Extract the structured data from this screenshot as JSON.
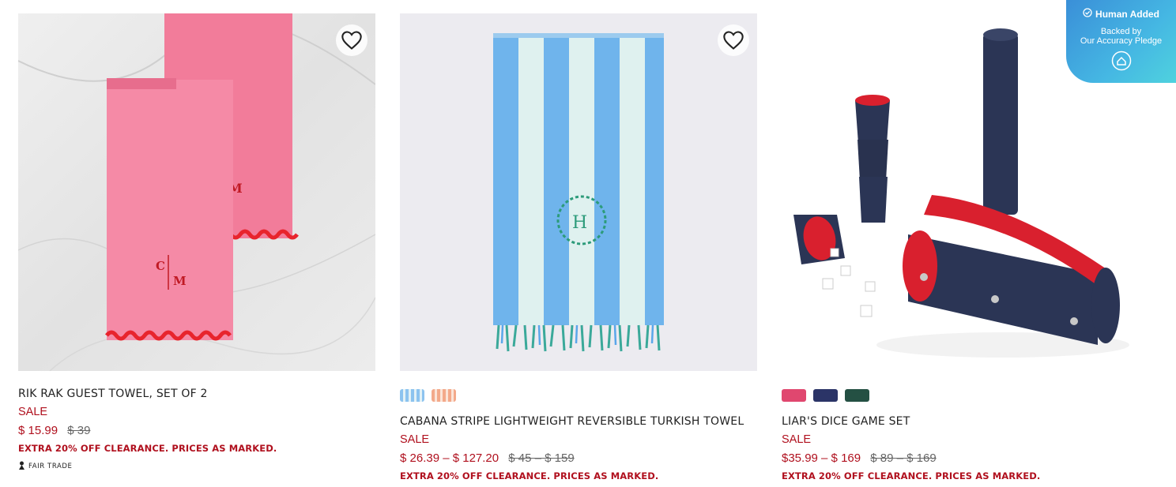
{
  "products": [
    {
      "title": "RIK RAK GUEST TOWEL, SET OF 2",
      "sale_label": "SALE",
      "price_now": "$ 15.99",
      "price_was": "$ 39",
      "promo": "EXTRA 20% OFF CLEARANCE. PRICES AS MARKED.",
      "badge_label": "FAIR TRADE",
      "monogram": "C|M"
    },
    {
      "title": "CABANA STRIPE LIGHTWEIGHT REVERSIBLE TURKISH TOWEL",
      "sale_label": "SALE",
      "price_now": "$ 26.39 – $ 127.20",
      "price_was": "$ 45 – $ 159",
      "promo": "EXTRA 20% OFF CLEARANCE. PRICES AS MARKED.",
      "monogram": "H",
      "swatches": [
        "blue-stripe",
        "peach-stripe"
      ]
    },
    {
      "title": "LIAR'S DICE GAME SET",
      "sale_label": "SALE",
      "price_now": "$35.99 – $ 169",
      "price_was": "$ 89 – $ 169",
      "promo": "EXTRA 20% OFF CLEARANCE. PRICES AS MARKED.",
      "swatches": [
        "#e0476f",
        "#2b3467",
        "#245043"
      ]
    }
  ],
  "overlay": {
    "human_added": "Human Added",
    "backed_by": "Backed by",
    "pledge": "Our Accuracy Pledge"
  },
  "icons": [
    "heart-icon",
    "check-circle-icon",
    "fair-trade-icon",
    "pledge-icon"
  ],
  "colors": {
    "sale_red": "#b0101e",
    "badge_blue": "#3a8fd8"
  }
}
